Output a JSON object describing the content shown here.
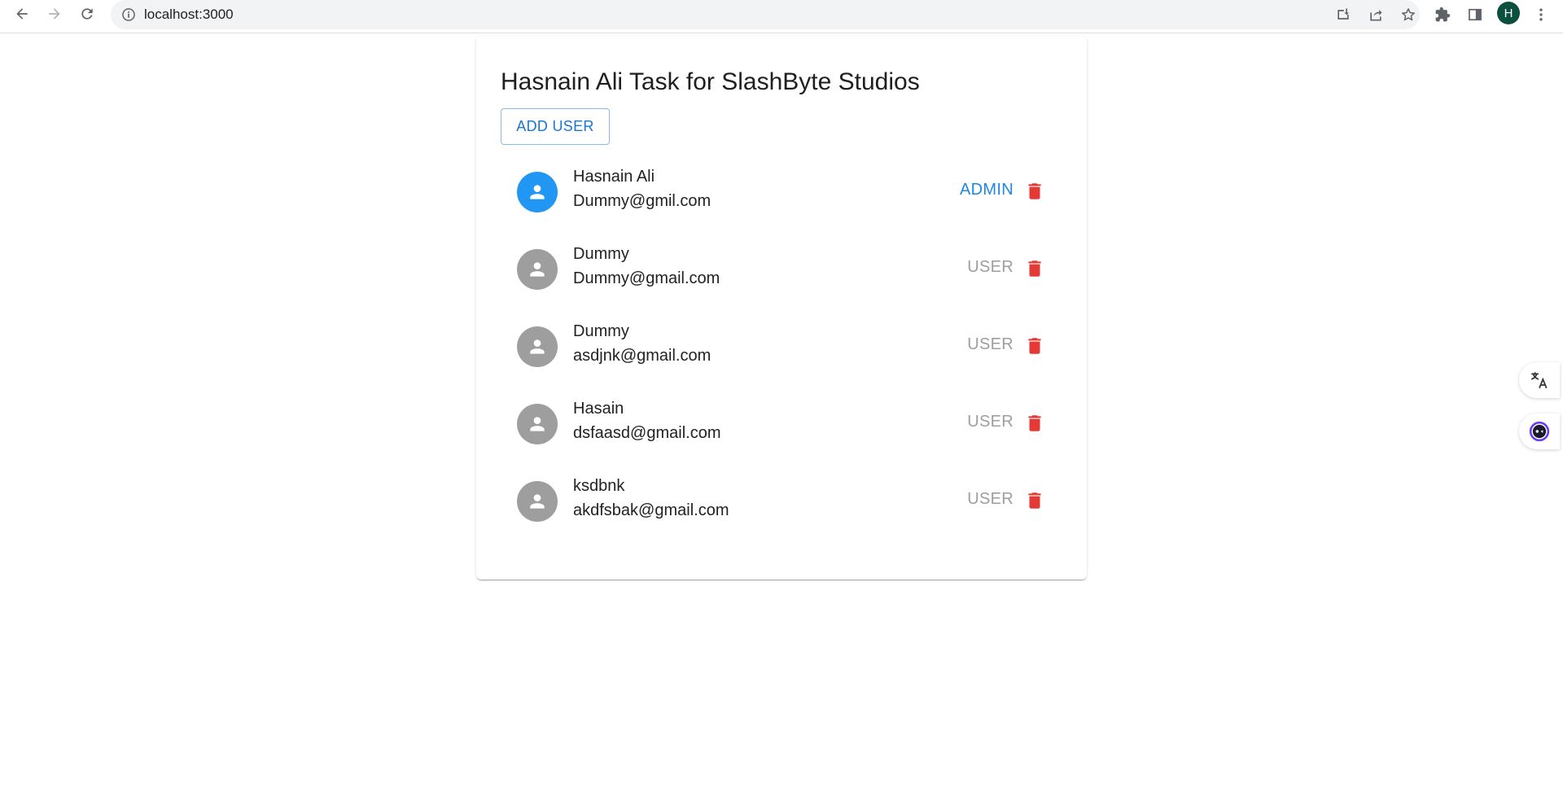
{
  "browser": {
    "url": "localhost:3000",
    "profile_initial": "H"
  },
  "page": {
    "title": "Hasnain Ali Task for SlashByte Studios",
    "add_user_label": "ADD USER"
  },
  "colors": {
    "admin": "#1e88e5",
    "user": "#9e9e9e",
    "delete": "#e53935",
    "avatar_admin": "#2196f3",
    "avatar_user": "#9e9e9e"
  },
  "users": [
    {
      "name": "Hasnain Ali",
      "email": "Dummy@gmil.com",
      "role": "ADMIN"
    },
    {
      "name": "Dummy",
      "email": "Dummy@gmail.com",
      "role": "USER"
    },
    {
      "name": "Dummy",
      "email": "asdjnk@gmail.com",
      "role": "USER"
    },
    {
      "name": "Hasain",
      "email": "dsfaasd@gmail.com",
      "role": "USER"
    },
    {
      "name": "ksdbnk",
      "email": "akdfsbak@gmail.com",
      "role": "USER"
    }
  ]
}
